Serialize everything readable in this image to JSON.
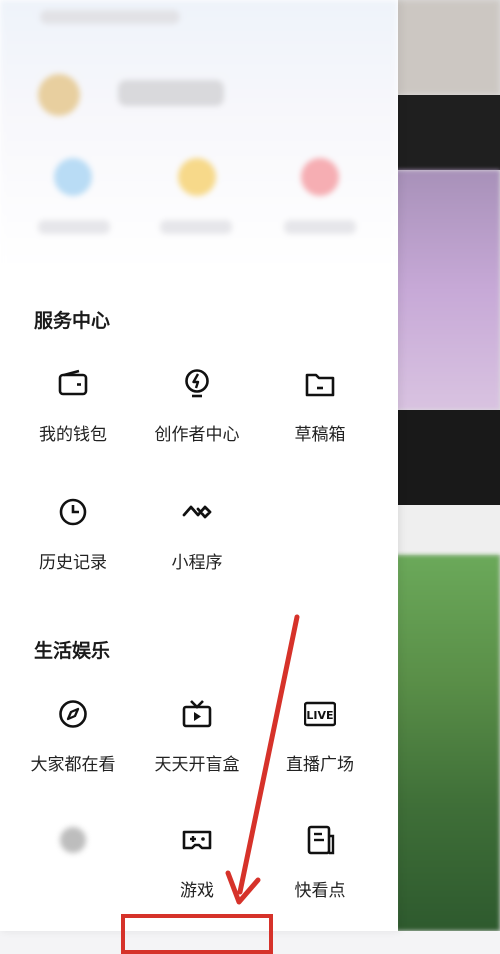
{
  "drawer": {
    "services": {
      "title": "服务中心",
      "items": [
        {
          "label": "我的钱包",
          "icon": "wallet-icon"
        },
        {
          "label": "创作者中心",
          "icon": "creator-icon"
        },
        {
          "label": "草稿箱",
          "icon": "folder-icon"
        },
        {
          "label": "历史记录",
          "icon": "clock-icon"
        },
        {
          "label": "小程序",
          "icon": "mini-program-icon"
        }
      ]
    },
    "life": {
      "title": "生活娱乐",
      "items": [
        {
          "label": "大家都在看",
          "icon": "compass-icon"
        },
        {
          "label": "天天开盲盒",
          "icon": "tv-play-icon"
        },
        {
          "label": "直播广场",
          "icon": "live-icon"
        },
        {
          "label": "",
          "icon": "blurred-app-icon"
        },
        {
          "label": "游戏",
          "icon": "gamepad-icon"
        },
        {
          "label": "快看点",
          "icon": "news-icon"
        }
      ]
    }
  },
  "colors": {
    "annotation_red": "#d6322a",
    "text_primary": "#1a1a1a"
  }
}
